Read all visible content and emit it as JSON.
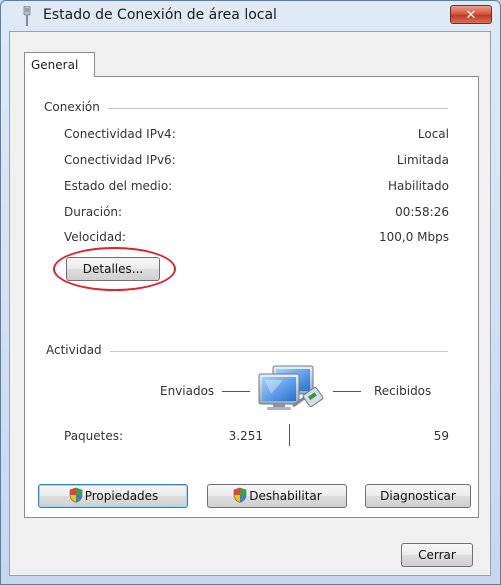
{
  "window": {
    "title": "Estado de Conexión de área local",
    "close_label": "✕"
  },
  "tabs": [
    {
      "label": "General",
      "selected": true
    }
  ],
  "connection": {
    "group_title": "Conexión",
    "rows": [
      {
        "label": "Conectividad IPv4:",
        "value": "Local"
      },
      {
        "label": "Conectividad IPv6:",
        "value": "Limitada"
      },
      {
        "label": "Estado del medio:",
        "value": "Habilitado"
      },
      {
        "label": "Duración:",
        "value": "00:58:26"
      },
      {
        "label": "Velocidad:",
        "value": "100,0 Mbps"
      }
    ],
    "details_button": "Detalles..."
  },
  "activity": {
    "group_title": "Actividad",
    "sent_label": "Enviados",
    "received_label": "Recibidos",
    "packets_label": "Paquetes:",
    "packets_sent": "3.251",
    "packets_received": "59"
  },
  "buttons": {
    "properties": "Propiedades",
    "disable": "Deshabilitar",
    "diagnose": "Diagnosticar",
    "close": "Cerrar"
  },
  "icons": {
    "title": "network-connection-icon",
    "activity": "network-computers-icon",
    "shield": "uac-shield-icon"
  },
  "colors": {
    "annotation": "#d8262c",
    "close_button": "#c23b25",
    "title_bar": "#c7d8ec"
  }
}
